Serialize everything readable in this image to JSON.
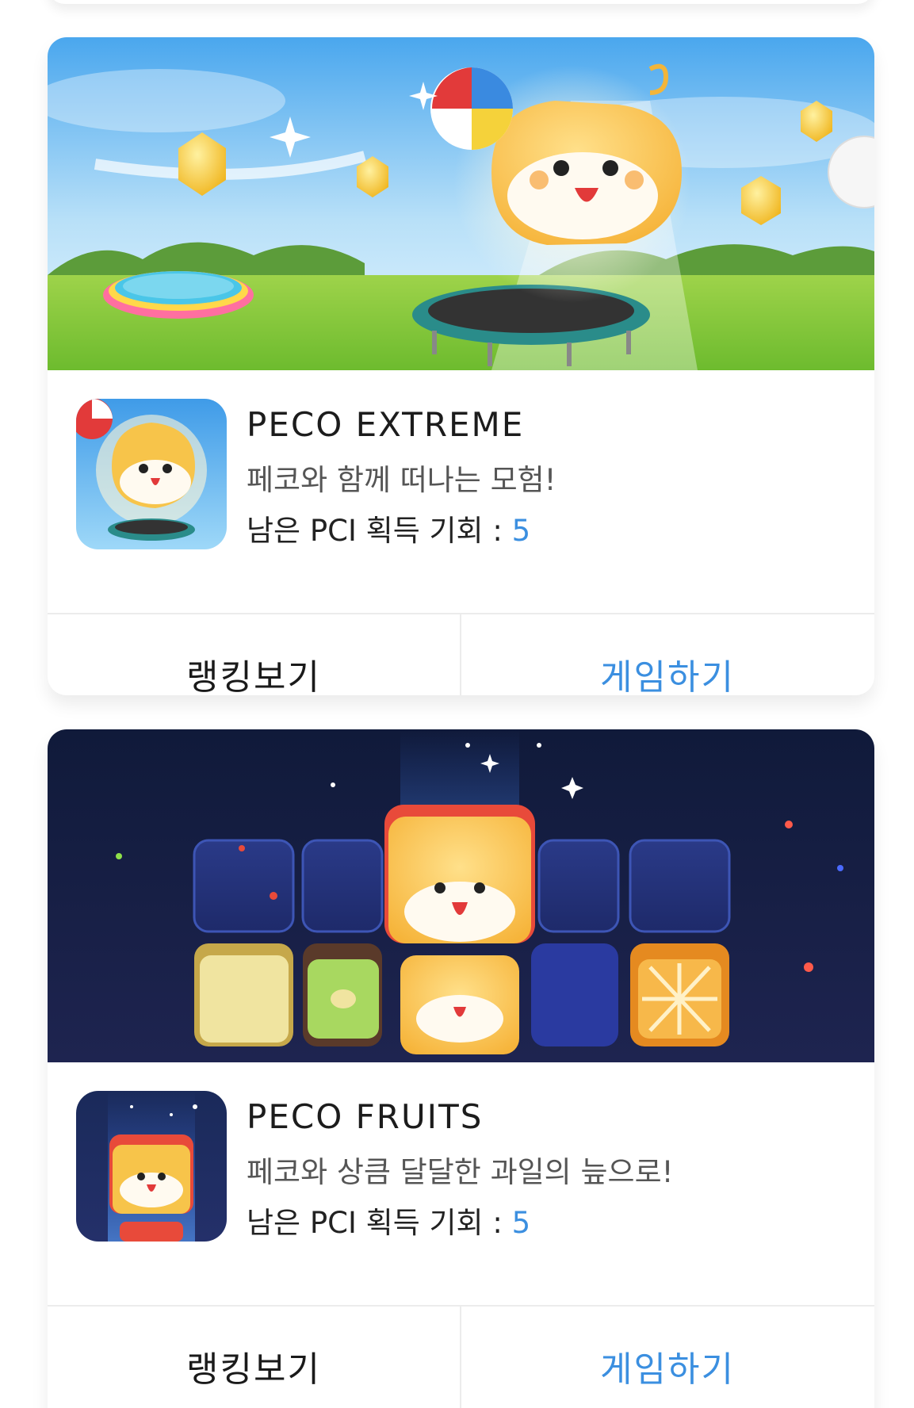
{
  "games": [
    {
      "title": "PECO EXTREME",
      "subtitle": "페코와 함께 떠나는 모험!",
      "chance_label": "남은 PCI 획득 기회 : ",
      "chance_count": "5",
      "ranking_label": "랭킹보기",
      "play_label": "게임하기"
    },
    {
      "title": "PECO FRUITS",
      "subtitle": "페코와 상큼 달달한 과일의 늪으로!",
      "chance_label": "남은 PCI 획득 기회 : ",
      "chance_count": "5",
      "ranking_label": "랭킹보기",
      "play_label": "게임하기"
    }
  ],
  "colors": {
    "accent": "#3b8fe0",
    "text": "#1a1a1a",
    "subtext": "#555555",
    "divider": "#ececec"
  }
}
